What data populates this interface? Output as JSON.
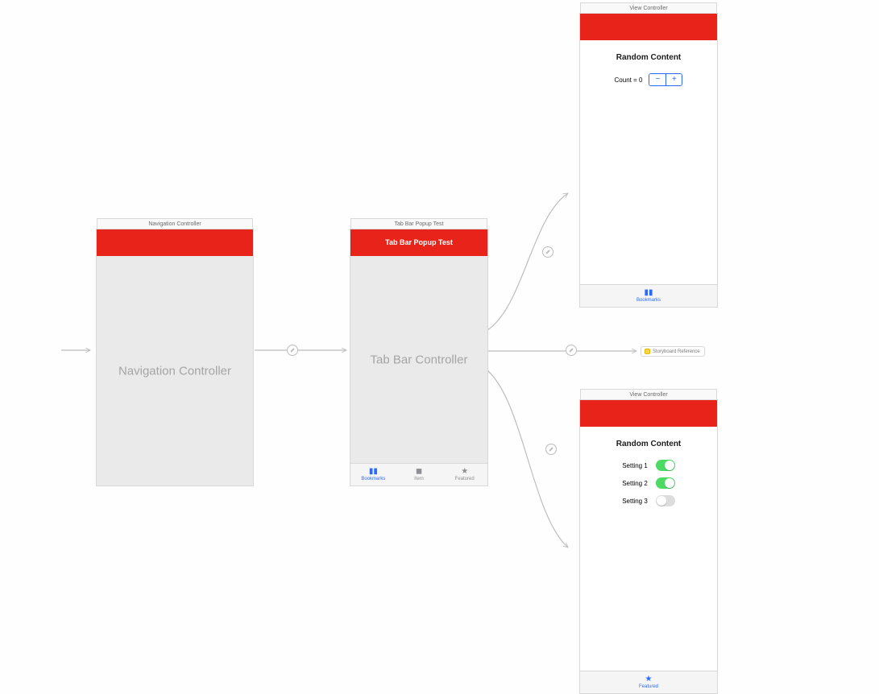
{
  "scenes": {
    "nav": {
      "title": "Navigation Controller",
      "center_label": "Navigation Controller"
    },
    "tabbar": {
      "title": "Tab Bar Popup Test",
      "nav_title": "Tab Bar Popup Test",
      "center_label": "Tab Bar Controller",
      "tabs": [
        {
          "label": "Bookmarks",
          "active": true,
          "icon": "bookmark-icon",
          "glyph": "▮▮"
        },
        {
          "label": "Item",
          "active": false,
          "icon": "square-icon",
          "glyph": "◼"
        },
        {
          "label": "Featured",
          "active": false,
          "icon": "star-icon",
          "glyph": "★"
        }
      ]
    },
    "vc_top": {
      "title": "View Controller",
      "header": "Random Content",
      "count_label": "Count = 0",
      "tabs": [
        {
          "label": "Bookmarks",
          "active": true,
          "icon": "bookmark-icon",
          "glyph": "▮▮"
        }
      ]
    },
    "vc_bottom": {
      "title": "View Controller",
      "header": "Random Content",
      "settings": [
        {
          "label": "Setting 1",
          "on": true
        },
        {
          "label": "Setting 2",
          "on": true
        },
        {
          "label": "Setting 3",
          "on": false
        }
      ],
      "tabs": [
        {
          "label": "Featured",
          "active": true,
          "icon": "star-icon",
          "glyph": "★"
        }
      ]
    },
    "storyboard_ref": {
      "label": "Storyboard Reference"
    }
  },
  "colors": {
    "brand": "#e8231a",
    "accent": "#2a6bff",
    "green": "#4cd964"
  }
}
